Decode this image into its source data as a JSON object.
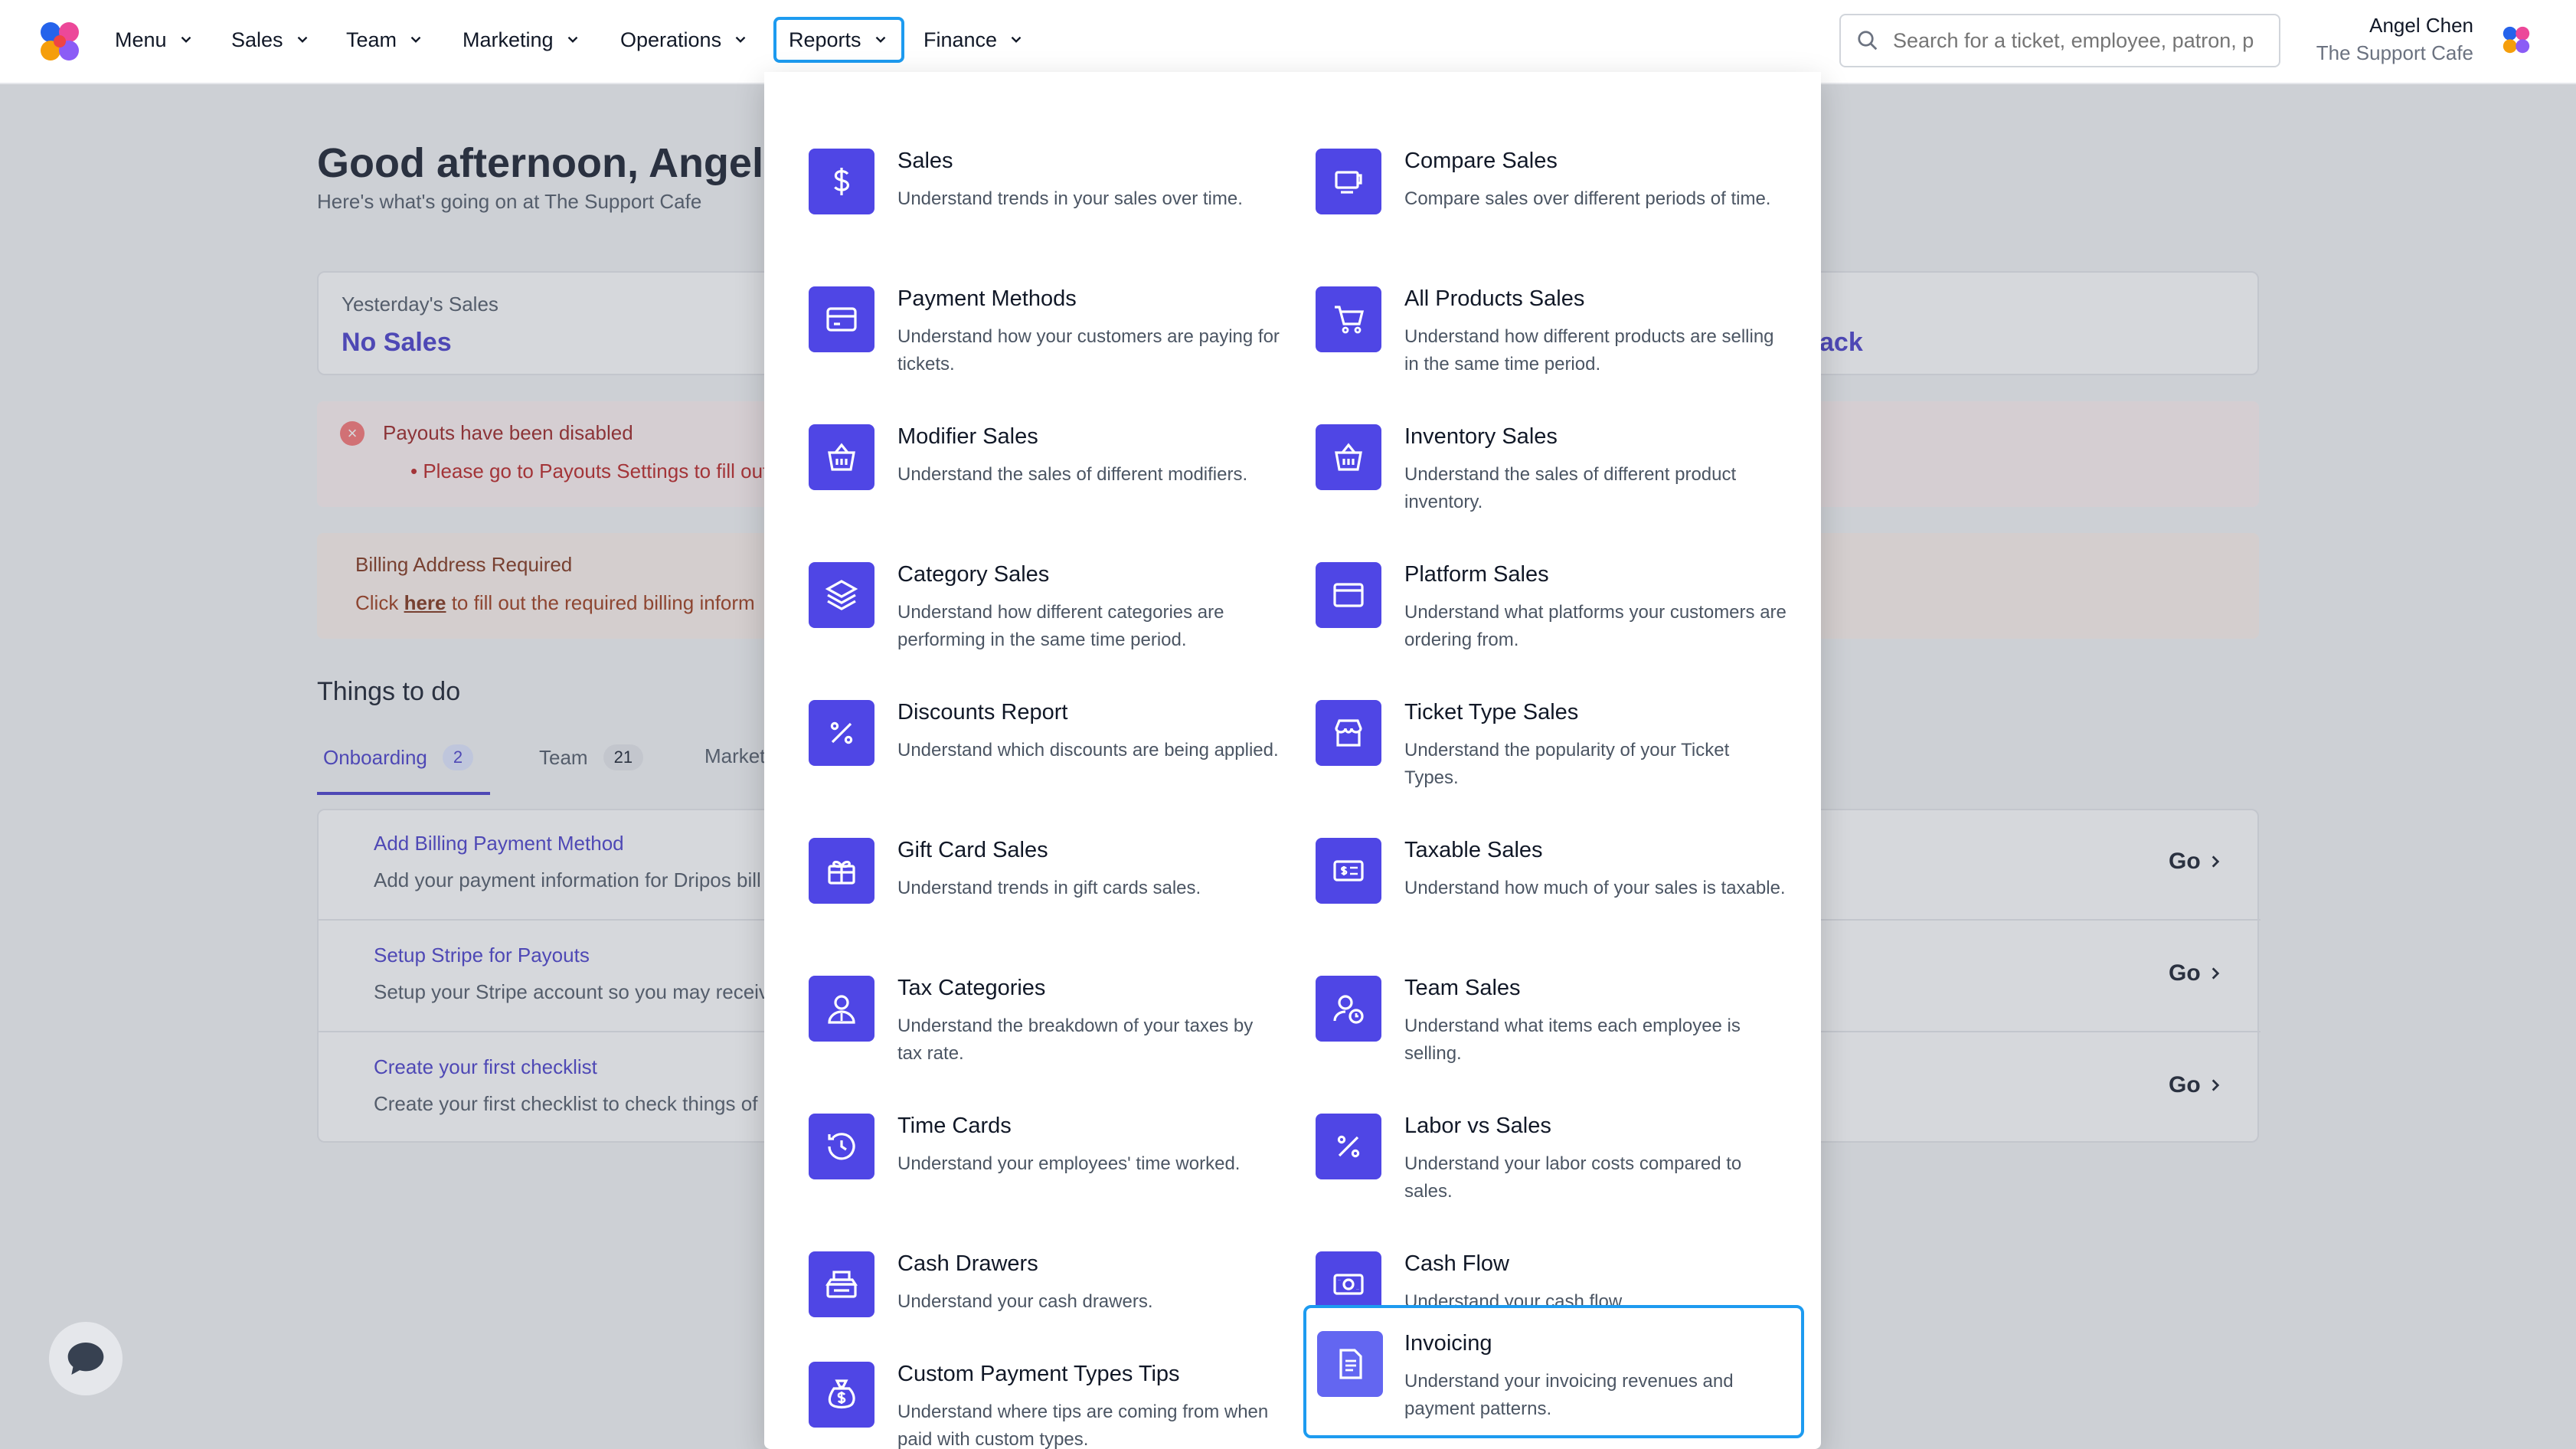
{
  "nav": {
    "items": [
      {
        "label": "Menu"
      },
      {
        "label": "Sales"
      },
      {
        "label": "Team"
      },
      {
        "label": "Marketing"
      },
      {
        "label": "Operations"
      },
      {
        "label": "Reports"
      },
      {
        "label": "Finance"
      }
    ],
    "active": "Reports",
    "search_placeholder": "Search for a ticket, employee, patron, p",
    "user_name": "Angel Chen",
    "user_org": "The Support Cafe"
  },
  "page": {
    "greeting": "Good afternoon, Angel",
    "subgreeting": "Here's what's going on at The Support Cafe",
    "sales_label": "Yesterday's Sales",
    "sales_value": "No Sales",
    "sales_right_fragment": "ack",
    "alert_title": "Payouts have been disabled",
    "alert_item": "Please go to Payouts Settings to fill out",
    "billing_title": "Billing Address Required",
    "billing_text_pre": "Click ",
    "billing_link": "here",
    "billing_text_post": " to fill out the required billing inform",
    "things_title": "Things to do",
    "tabs": [
      {
        "label": "Onboarding",
        "count": "2"
      },
      {
        "label": "Team",
        "count": "21"
      },
      {
        "label": "Market",
        "count": ""
      }
    ],
    "todos": [
      {
        "title": "Add Billing Payment Method",
        "desc": "Add your payment information for Dripos bill",
        "go": "Go"
      },
      {
        "title": "Setup Stripe for Payouts",
        "desc": "Setup your Stripe account so you may receiv",
        "go": "Go"
      },
      {
        "title": "Create your first checklist",
        "desc": "Create your first checklist to check things of",
        "go": "Go"
      }
    ]
  },
  "reports_menu": {
    "left": [
      {
        "title": "Sales",
        "desc": "Understand trends in your sales over time.",
        "icon": "dollar-icon"
      },
      {
        "title": "Payment Methods",
        "desc": "Understand how your customers are paying for tickets.",
        "icon": "credit-card-icon"
      },
      {
        "title": "Modifier Sales",
        "desc": "Understand the sales of different modifiers.",
        "icon": "basket-icon"
      },
      {
        "title": "Category Sales",
        "desc": "Understand how different categories are performing in the same time period.",
        "icon": "layers-icon"
      },
      {
        "title": "Discounts Report",
        "desc": "Understand which discounts are being applied.",
        "icon": "percent-icon"
      },
      {
        "title": "Gift Card Sales",
        "desc": "Understand trends in gift cards sales.",
        "icon": "gift-icon"
      },
      {
        "title": "Tax Categories",
        "desc": "Understand the breakdown of your taxes by tax rate.",
        "icon": "user-tax-icon"
      },
      {
        "title": "Time Cards",
        "desc": "Understand your employees' time worked.",
        "icon": "history-icon"
      },
      {
        "title": "Cash Drawers",
        "desc": "Understand your cash drawers.",
        "icon": "register-icon"
      },
      {
        "title": "Custom Payment Types Tips",
        "desc": "Understand where tips are coming from when paid with custom types.",
        "icon": "money-bag-icon"
      }
    ],
    "right": [
      {
        "title": "Compare Sales",
        "desc": "Compare sales over different periods of time.",
        "icon": "cup-icon"
      },
      {
        "title": "All Products Sales",
        "desc": "Understand how different products are selling in the same time period.",
        "icon": "cart-icon"
      },
      {
        "title": "Inventory Sales",
        "desc": "Understand the sales of different product inventory.",
        "icon": "basket-icon"
      },
      {
        "title": "Platform Sales",
        "desc": "Understand what platforms your customers are ordering from.",
        "icon": "browser-icon"
      },
      {
        "title": "Ticket Type Sales",
        "desc": "Understand the popularity of your Ticket Types.",
        "icon": "store-icon"
      },
      {
        "title": "Taxable Sales",
        "desc": "Understand how much of your sales is taxable.",
        "icon": "tax-bill-icon"
      },
      {
        "title": "Team Sales",
        "desc": "Understand what items each employee is selling.",
        "icon": "user-clock-icon"
      },
      {
        "title": "Labor vs Sales",
        "desc": "Understand your labor costs compared to sales.",
        "icon": "percent-icon"
      },
      {
        "title": "Cash Flow",
        "desc": "Understand your cash flow.",
        "icon": "cash-icon"
      },
      {
        "title": "Invoicing",
        "desc": "Understand your invoicing revenues and payment patterns.",
        "icon": "invoice-icon"
      }
    ],
    "highlighted": "Invoicing"
  }
}
